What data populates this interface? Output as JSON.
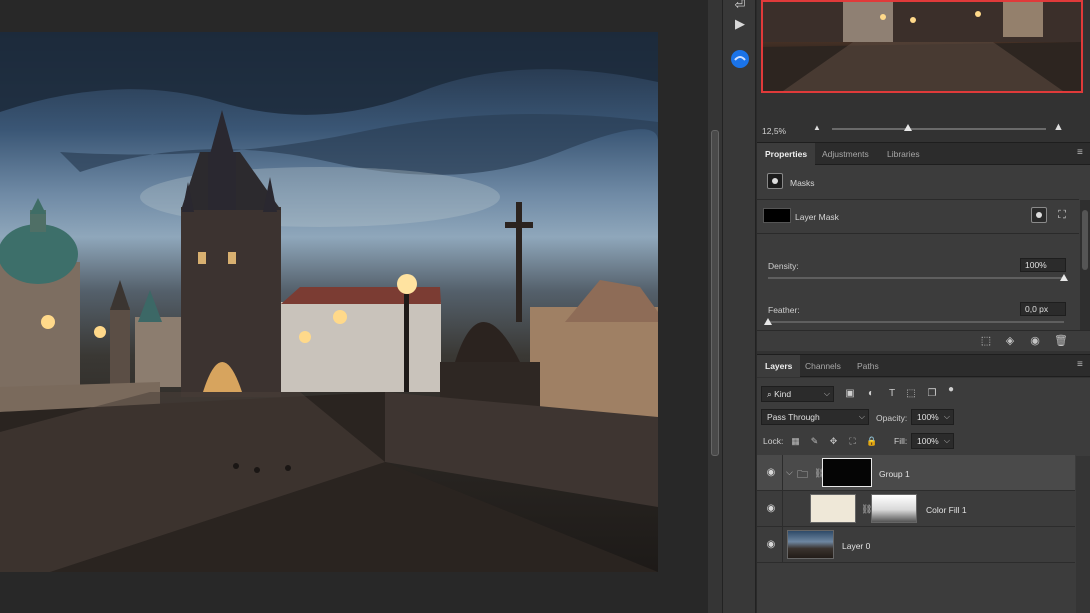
{
  "navigator": {
    "zoom": "12,5%"
  },
  "properties_panel": {
    "tabs": [
      "Properties",
      "Adjustments",
      "Libraries"
    ],
    "section_title": "Masks",
    "layer_mask_label": "Layer Mask",
    "density": {
      "label": "Density:",
      "value": "100%",
      "level": 1.0
    },
    "feather": {
      "label": "Feather:",
      "value": "0,0 px",
      "level": 0.0
    }
  },
  "layers_panel": {
    "tabs": [
      "Layers",
      "Channels",
      "Paths"
    ],
    "filter": {
      "kind": "Kind"
    },
    "blend_mode": "Pass Through",
    "opacity": {
      "label": "Opacity:",
      "value": "100%"
    },
    "lock_label": "Lock:",
    "fill": {
      "label": "Fill:",
      "value": "100%"
    },
    "layers": [
      {
        "name": "Group 1",
        "selected": true,
        "type": "group"
      },
      {
        "name": "Color Fill 1",
        "selected": false,
        "type": "fill"
      },
      {
        "name": "Layer 0",
        "selected": false,
        "type": "pixel"
      }
    ]
  },
  "colors": {
    "navigator_frame": "#e03a3a",
    "selected_layer": "#4a4a4a",
    "brand_tool": "#1a73e8",
    "fill_color": "#efe8d8"
  },
  "icons": {
    "tool_strip": [
      "play-icon",
      "brush-circle-icon"
    ]
  }
}
